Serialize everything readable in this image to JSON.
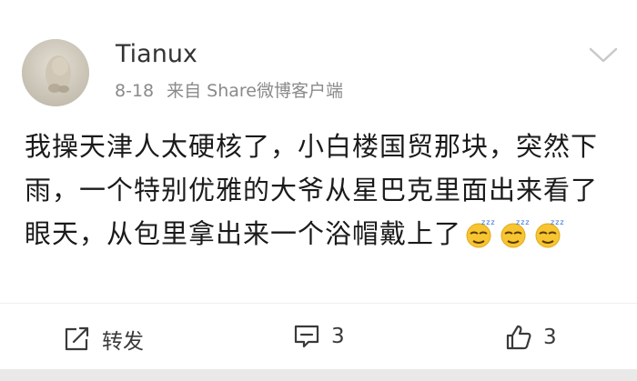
{
  "post": {
    "username": "Tianux",
    "date": "8-18",
    "source": "来自 Share微博客户端",
    "text": "我操天津人太硬核了，小白楼国贸那块，突然下雨，一个特别优雅的大爷从星巴克里面出来看了眼天，从包里拿出来一个浴帽戴上了",
    "emojis": [
      "sleepy-emoji",
      "sleepy-emoji",
      "sleepy-emoji"
    ]
  },
  "actions": {
    "repost_label": "转发",
    "comment_count": "3",
    "like_count": "3"
  },
  "colors": {
    "text": "#1a1a1a",
    "meta": "#8a8a8a",
    "icon": "#3a3a3a",
    "background": "#e9e9e9"
  }
}
